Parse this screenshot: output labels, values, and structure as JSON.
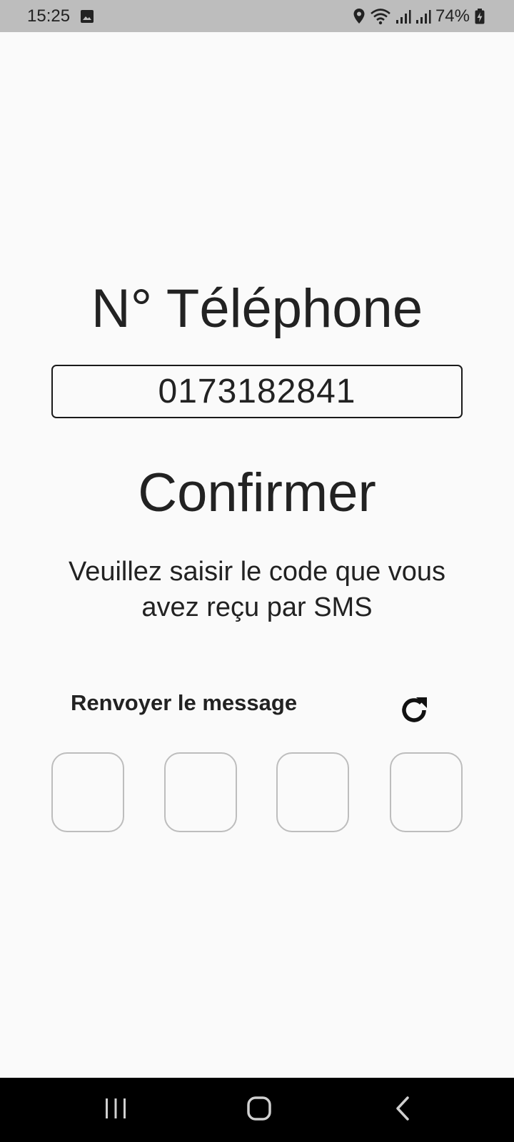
{
  "status_bar": {
    "time": "15:25",
    "battery": "74%"
  },
  "form": {
    "phone_title": "N° Téléphone",
    "phone_value": "0173182841",
    "confirm_title": "Confirmer",
    "instructions": "Veuillez saisir le code que vous avez reçu par SMS",
    "resend_label": "Renvoyer le message",
    "code_digits": [
      "",
      "",
      "",
      ""
    ]
  },
  "icons": {
    "refresh": "refresh-icon",
    "recents": "recents-icon",
    "home": "home-icon",
    "back": "back-icon"
  }
}
